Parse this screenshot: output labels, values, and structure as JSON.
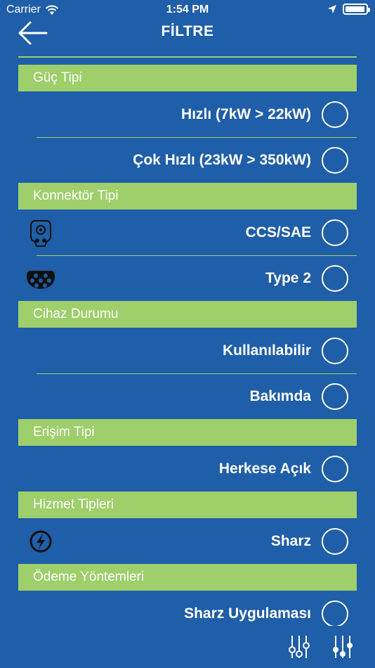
{
  "status_bar": {
    "carrier": "Carrier",
    "time": "1:54 PM",
    "battery_level": 0.95
  },
  "header": {
    "title": "FİLTRE"
  },
  "sections": {
    "guc_tipi": {
      "title": "Güç Tipi",
      "options": [
        {
          "label": "Hızlı (7kW > 22kW)",
          "selected": false
        },
        {
          "label": "Çok Hızlı (23kW > 350kW)",
          "selected": false
        }
      ]
    },
    "konnektor_tipi": {
      "title": "Konnektör Tipi",
      "options": [
        {
          "label": "CCS/SAE",
          "icon": "ccs-connector-icon",
          "selected": false
        },
        {
          "label": "Type 2",
          "icon": "type2-connector-icon",
          "selected": false
        }
      ]
    },
    "cihaz_durumu": {
      "title": "Cihaz Durumu",
      "options": [
        {
          "label": "Kullanılabilir",
          "selected": false
        },
        {
          "label": "Bakımda",
          "selected": false
        }
      ]
    },
    "erisim_tipi": {
      "title": "Erişim Tipi",
      "options": [
        {
          "label": "Herkese Açık",
          "selected": false
        }
      ]
    },
    "hizmet_tipleri": {
      "title": "Hizmet Tipleri",
      "options": [
        {
          "label": "Sharz",
          "icon": "lightning-icon",
          "selected": false
        }
      ]
    },
    "odeme_yontemleri": {
      "title": "Ödeme Yöntemleri",
      "options": [
        {
          "label": "Sharz Uygulaması",
          "selected": false
        }
      ]
    }
  },
  "colors": {
    "background": "#1f5ea8",
    "accent": "#9ecf6a",
    "text": "#ffffff"
  },
  "bottom_bar": {
    "icons": [
      "filter-sliders-icon",
      "filter-sliders-filled-icon"
    ]
  }
}
